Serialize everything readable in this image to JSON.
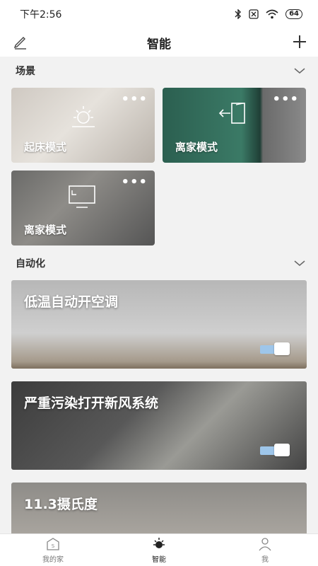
{
  "status": {
    "time": "下午2:56",
    "battery": "64"
  },
  "header": {
    "title": "智能"
  },
  "scenes": {
    "section_label": "场景",
    "items": [
      {
        "name": "起床模式"
      },
      {
        "name": "离家模式"
      },
      {
        "name": "离家模式"
      }
    ],
    "more_label": "•••"
  },
  "automation": {
    "section_label": "自动化",
    "items": [
      {
        "title": "低温自动开空调",
        "enabled": true
      },
      {
        "title": "严重污染打开新风系统",
        "enabled": true
      },
      {
        "title": "11.3摄氏度"
      }
    ]
  },
  "tabs": [
    {
      "label": "我的家",
      "icon": "home-icon"
    },
    {
      "label": "智能",
      "icon": "sun-icon"
    },
    {
      "label": "我",
      "icon": "person-icon"
    }
  ],
  "colors": {
    "toggle_on": "#9ec6ea",
    "scene2_bg": "#2f6b5a"
  }
}
